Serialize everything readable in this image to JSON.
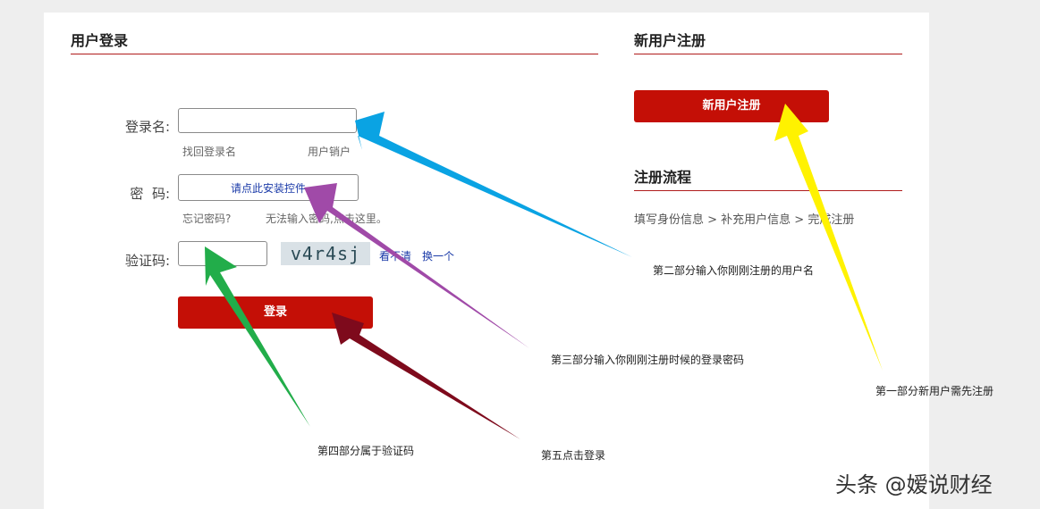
{
  "login": {
    "title": "用户登录",
    "username_label": "登录名:",
    "username_value": "",
    "forgot_username": "找回登录名",
    "cancel_account": "用户销户",
    "password_label": "密  码:",
    "password_plugin_link": "请点此安装控件",
    "forgot_password": "忘记密码?",
    "cannot_input_password": "无法输入密码,点击这里。",
    "captcha_label": "验证码:",
    "captcha_value": "",
    "captcha_image_text": "v4r4sj",
    "captcha_unclear": "看不清",
    "captcha_refresh": "换一个",
    "login_button": "登录"
  },
  "register": {
    "title": "新用户注册",
    "register_button": "新用户注册",
    "process_title": "注册流程",
    "process_steps": "填写身份信息 > 补充用户信息 > 完成注册"
  },
  "annotations": {
    "part1": "第一部分新用户需先注册",
    "part2": "第二部分输入你刚刚注册的用户名",
    "part3": "第三部分输入你刚刚注册时候的登录密码",
    "part4": "第四部分属于验证码",
    "part5": "第五点击登录"
  },
  "arrow_colors": {
    "blue": "#0aa3e3",
    "purple": "#a04aa8",
    "green": "#22ad4a",
    "darkred": "#7e0a1c",
    "yellow": "#fff200"
  },
  "watermark": "头条 @嫒说财经"
}
